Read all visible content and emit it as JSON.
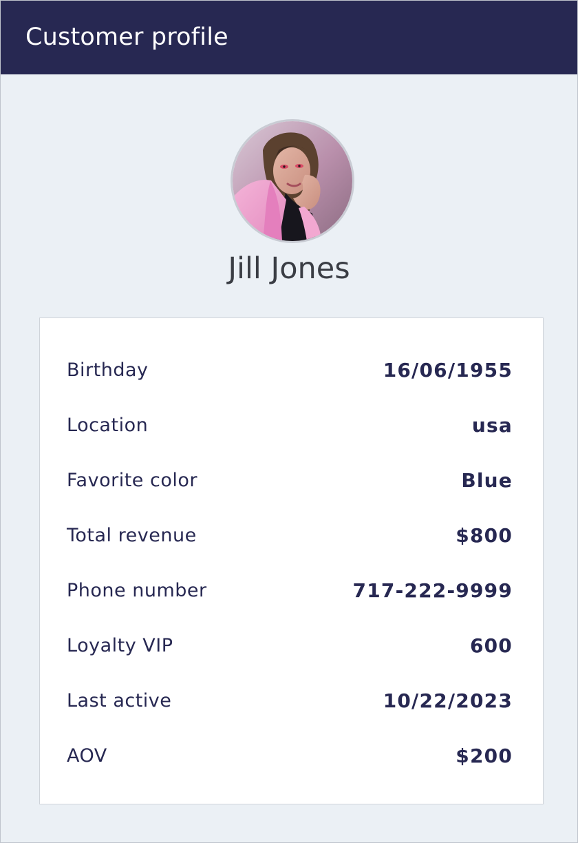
{
  "header": {
    "title": "Customer profile",
    "background_color": "#272852"
  },
  "profile": {
    "name": "Jill Jones",
    "avatar_icon": "customer-photo"
  },
  "details": [
    {
      "label": "Birthday",
      "value": "16/06/1955"
    },
    {
      "label": "Location",
      "value": "usa"
    },
    {
      "label": "Favorite color",
      "value": "Blue"
    },
    {
      "label": "Total revenue",
      "value": "$800"
    },
    {
      "label": "Phone number",
      "value": "717-222-9999"
    },
    {
      "label": "Loyalty VIP",
      "value": "600"
    },
    {
      "label": "Last active",
      "value": "10/22/2023"
    },
    {
      "label": "AOV",
      "value": "$200"
    }
  ],
  "colors": {
    "text_primary": "#272852",
    "panel_background": "#EBF0F5",
    "card_background": "#FFFFFF"
  }
}
